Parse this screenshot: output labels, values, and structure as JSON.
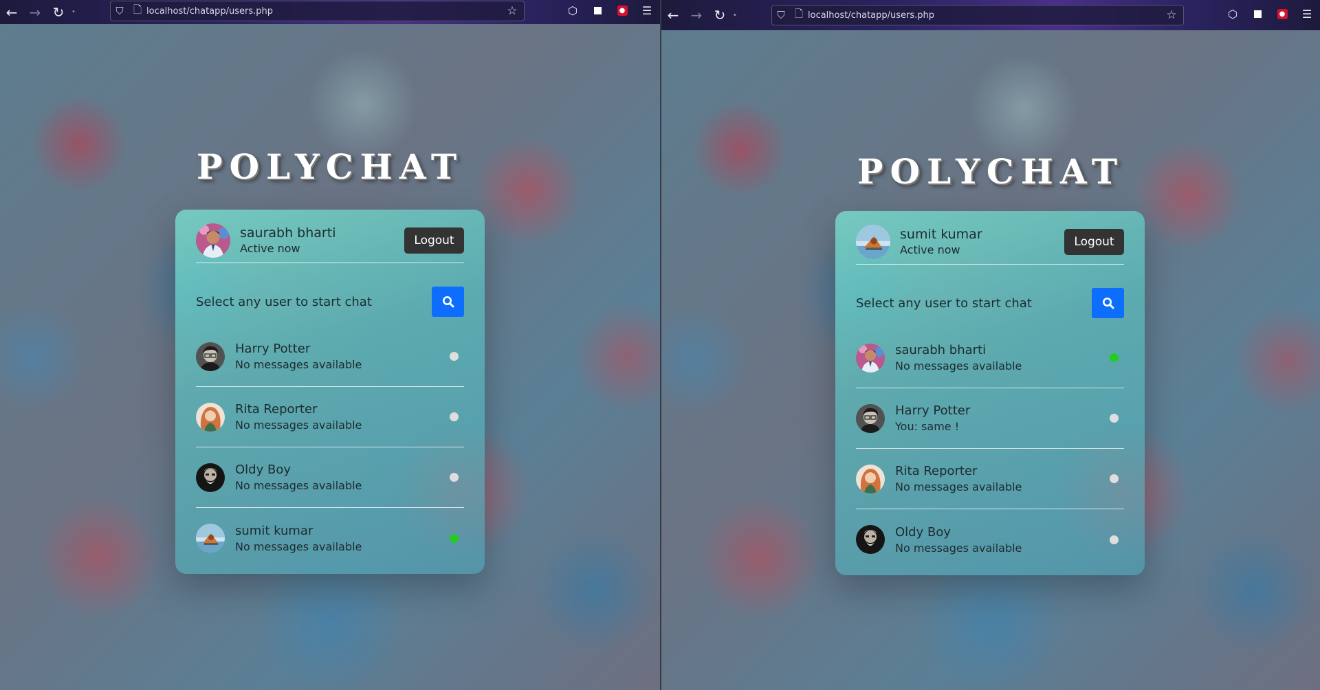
{
  "browser": {
    "url": "localhost/chatapp/users.php"
  },
  "app": {
    "brand": "POLYCHAT",
    "logout_label": "Logout",
    "search_prompt": "Select any user to start chat",
    "online_color": "#22cc22",
    "offline_color": "#dedede"
  },
  "left": {
    "me": {
      "name": "saurabh bharti",
      "status": "Active now",
      "avatar": "avatar-saurabh"
    },
    "users": [
      {
        "name": "Harry Potter",
        "message": "No messages available",
        "status": "offline",
        "avatar": "avatar-harry"
      },
      {
        "name": "Rita Reporter",
        "message": "No messages available",
        "status": "offline",
        "avatar": "avatar-rita"
      },
      {
        "name": "Oldy Boy",
        "message": "No messages available",
        "status": "offline",
        "avatar": "avatar-oldy"
      },
      {
        "name": "sumit kumar",
        "message": "No messages available",
        "status": "online",
        "avatar": "avatar-sumit"
      }
    ]
  },
  "right": {
    "me": {
      "name": "sumit kumar",
      "status": "Active now",
      "avatar": "avatar-sumit"
    },
    "users": [
      {
        "name": "saurabh bharti",
        "message": "No messages available",
        "status": "online",
        "avatar": "avatar-saurabh"
      },
      {
        "name": "Harry Potter",
        "message": "You: same !",
        "status": "offline",
        "avatar": "avatar-harry"
      },
      {
        "name": "Rita Reporter",
        "message": "No messages available",
        "status": "offline",
        "avatar": "avatar-rita"
      },
      {
        "name": "Oldy Boy",
        "message": "No messages available",
        "status": "offline",
        "avatar": "avatar-oldy"
      }
    ]
  }
}
